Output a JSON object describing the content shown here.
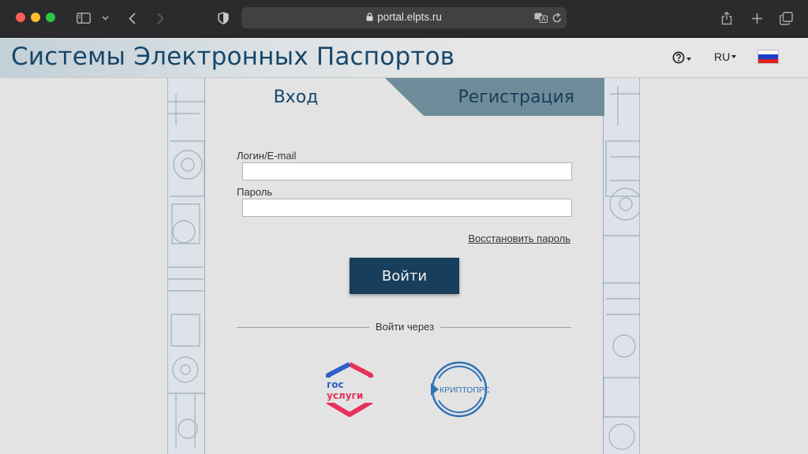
{
  "browser": {
    "url": "portal.elpts.ru",
    "icons": [
      "sidebar-icon",
      "chevron-down-icon",
      "back-icon",
      "forward-icon",
      "shield-icon",
      "lock-icon",
      "translate-icon",
      "reload-icon",
      "share-icon",
      "new-tab-icon",
      "tabs-overview-icon"
    ]
  },
  "header": {
    "title": "Системы Электронных Паспортов",
    "language": "RU",
    "flag_colors": [
      "#ffffff",
      "#1c3fc8",
      "#e0201c"
    ]
  },
  "tabs": {
    "login": "Вход",
    "register": "Регистрация"
  },
  "form": {
    "login_label": "Логин/E-mail",
    "login_value": "",
    "password_label": "Пароль",
    "password_value": "",
    "forgot_link": "Восстановить пароль",
    "submit_label": "Войти",
    "alt_login_text": "Войти через"
  },
  "providers": {
    "gosuslugi": {
      "line1": "гос",
      "line2": "услуги"
    },
    "cryptopro": {
      "text": "КРИПТОПРО"
    }
  },
  "colors": {
    "brand": "#17476a",
    "button": "#173e5c",
    "tab_inactive": "#6f8c9b"
  }
}
